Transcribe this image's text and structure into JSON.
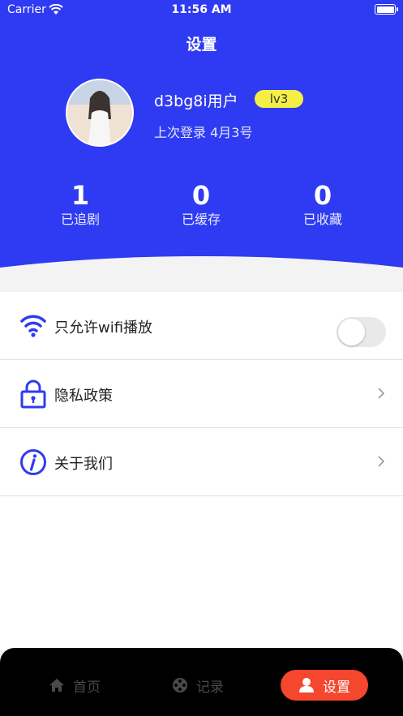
{
  "status_bar": {
    "carrier": "Carrier",
    "time": "11:56 AM"
  },
  "header": {
    "title": "设置"
  },
  "profile": {
    "username": "d3bg8i用户",
    "level": "lv3",
    "last_login": "上次登录 4月3号"
  },
  "stats": [
    {
      "value": "1",
      "label": "已追剧"
    },
    {
      "value": "0",
      "label": "已缓存"
    },
    {
      "value": "0",
      "label": "已收藏"
    }
  ],
  "settings": {
    "wifi_only": {
      "label": "只允许wifi播放",
      "enabled": false
    },
    "privacy": {
      "label": "隐私政策"
    },
    "about": {
      "label": "关于我们"
    }
  },
  "tabbar": {
    "home": "首页",
    "record": "记录",
    "settings": "设置",
    "active": "settings"
  },
  "colors": {
    "brand_blue": "#2f3bf2",
    "badge_yellow": "#f5ee45",
    "active_tab": "#f5462e",
    "icon_blue": "#2f3bf2"
  }
}
